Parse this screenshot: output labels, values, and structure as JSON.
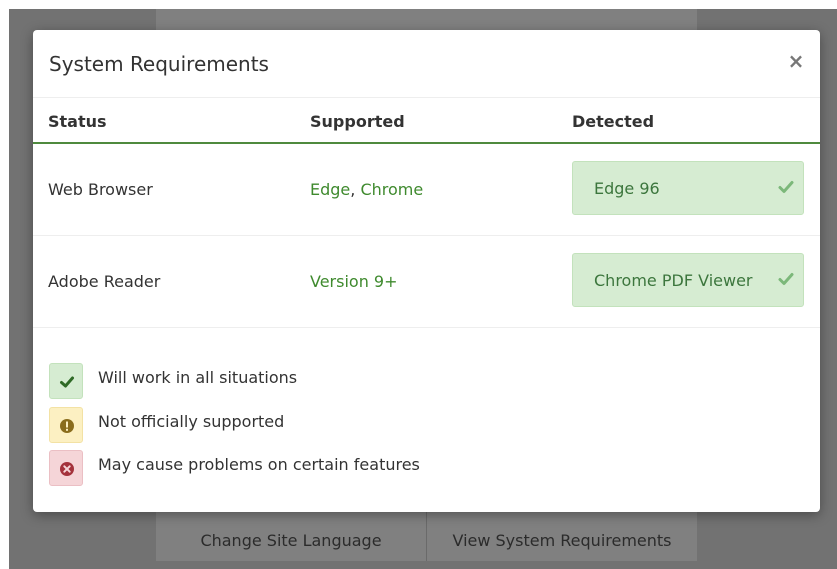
{
  "background": {
    "buttons": [
      "Change Site Language",
      "View System Requirements"
    ]
  },
  "modal": {
    "title": "System Requirements",
    "close_label": "×",
    "columns": [
      "Status",
      "Supported",
      "Detected"
    ],
    "rows": [
      {
        "name": "Web Browser",
        "supported_1": "Edge",
        "supported_sep": ", ",
        "supported_2": "Chrome",
        "detected": "Edge 96",
        "status_icon": "check-icon"
      },
      {
        "name": "Adobe Reader",
        "supported_1": "Version 9+",
        "detected": "Chrome PDF Viewer",
        "status_icon": "check-icon"
      }
    ],
    "legend": [
      {
        "text": "Will work in all situations",
        "icon": "check-icon",
        "color": "#d6ecd2"
      },
      {
        "text": "Not officially supported",
        "icon": "exclamation-icon",
        "color": "#fcf0c2"
      },
      {
        "text": "May cause problems on certain features",
        "icon": "x-circle-icon",
        "color": "#f5d5d8"
      }
    ]
  },
  "colors": {
    "accent_green": "#4f8a3e",
    "success_bg": "#d6ecd2",
    "warning_bg": "#fcf0c2",
    "danger_bg": "#f5d5d8"
  }
}
